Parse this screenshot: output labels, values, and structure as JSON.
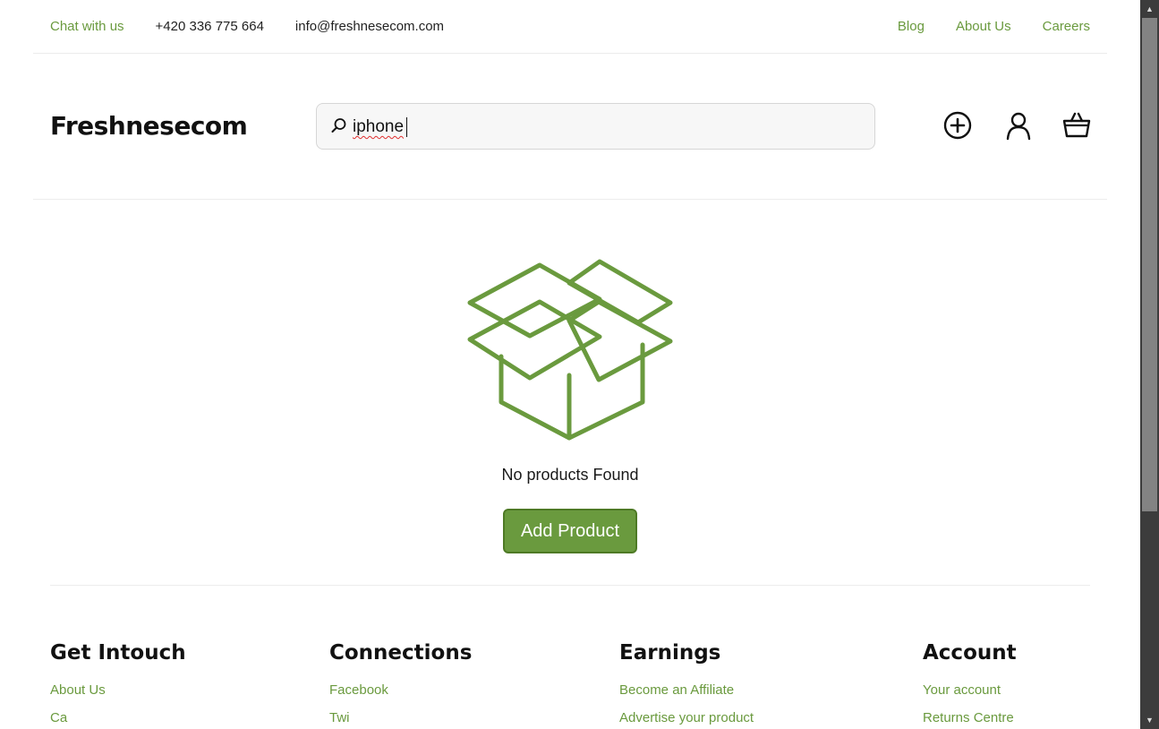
{
  "topbar": {
    "chat": "Chat with us",
    "phone": "+420 336 775 664",
    "email": "info@freshnesecom.com",
    "links": [
      "Blog",
      "About Us",
      "Careers"
    ]
  },
  "header": {
    "logo": "Freshnesecom",
    "search_value": "iphone",
    "icons": [
      "add-circle-icon",
      "user-icon",
      "basket-icon"
    ]
  },
  "empty": {
    "icon": "open-box-icon",
    "message": "No products Found",
    "button": "Add Product"
  },
  "footer": {
    "columns": [
      {
        "title": "Get Intouch",
        "links": [
          "About Us",
          "Ca"
        ]
      },
      {
        "title": "Connections",
        "links": [
          "Facebook",
          "Twi"
        ]
      },
      {
        "title": "Earnings",
        "links": [
          "Become an Affiliate",
          "Advertise your product"
        ]
      },
      {
        "title": "Account",
        "links": [
          "Your account",
          "Returns Centre"
        ]
      }
    ]
  },
  "colors": {
    "accent": "#6a9a3e",
    "accent_border": "#4e7a25",
    "text": "#1a1a1a"
  }
}
